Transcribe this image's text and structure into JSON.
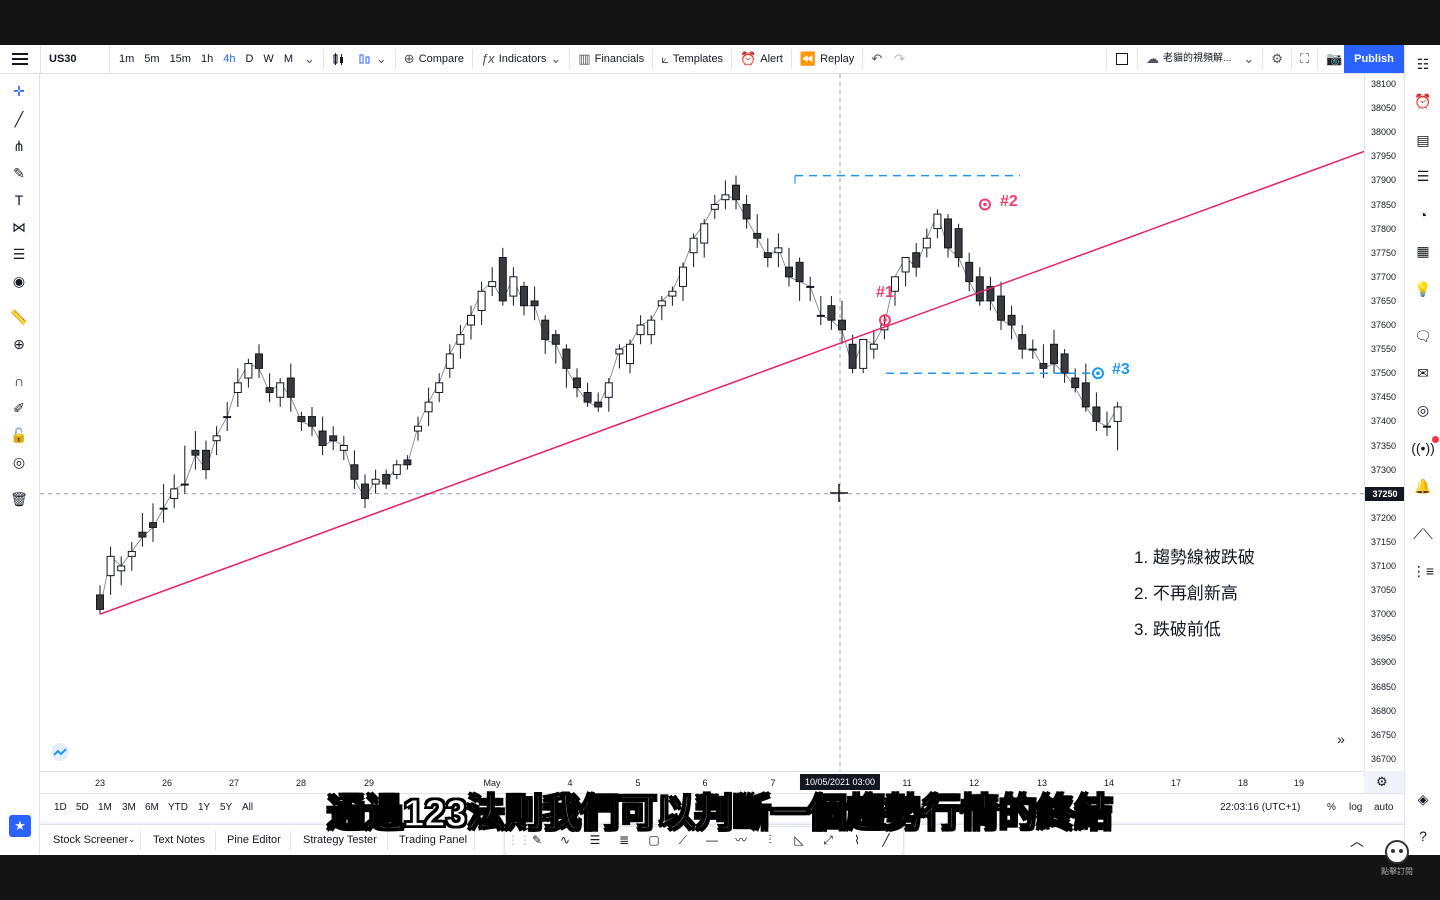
{
  "header": {
    "symbol": "US30",
    "intervals": [
      "1m",
      "5m",
      "15m",
      "1h",
      "4h",
      "D",
      "W",
      "M"
    ],
    "active_interval": "4h",
    "compare": "Compare",
    "indicators": "Indicators",
    "financials": "Financials",
    "templates": "Templates",
    "alert": "Alert",
    "replay": "Replay",
    "layout_name": "老貓的視頻解...",
    "publish": "Publish"
  },
  "price_axis": {
    "labels": [
      "38100",
      "38050",
      "38000",
      "37950",
      "37900",
      "37850",
      "37800",
      "37750",
      "37700",
      "37650",
      "37600",
      "37550",
      "37500",
      "37450",
      "37400",
      "37350",
      "37300",
      "37250",
      "37200",
      "37150",
      "37100",
      "37050",
      "37000",
      "36950",
      "36900",
      "36850",
      "36800",
      "36750",
      "36700"
    ],
    "current": "37250"
  },
  "time_axis": {
    "labels": [
      "23",
      "26",
      "27",
      "28",
      "29",
      "May",
      "4",
      "5",
      "6",
      "7",
      "11",
      "12",
      "13",
      "14",
      "17",
      "18",
      "19"
    ],
    "current": "10/05/2021  03:00"
  },
  "range_bar": {
    "ranges": [
      "1D",
      "5D",
      "1M",
      "3M",
      "6M",
      "YTD",
      "1Y",
      "5Y",
      "All"
    ],
    "clock": "22:03:16 (UTC+1)",
    "percent": "%",
    "log": "log",
    "auto": "auto"
  },
  "bottom_tabs": [
    "Stock Screener",
    "Text Notes",
    "Pine Editor",
    "Strategy Tester",
    "Trading Panel"
  ],
  "annotations": {
    "marker1": "#1",
    "marker2": "#2",
    "marker3": "#3",
    "notes": [
      "1. 趨勢線被跌破",
      "2. 不再創新高",
      "3. 跌破前低"
    ]
  },
  "subtitle": "通過123法則我們可以判斷一個趨勢行情的終結",
  "watermark": "點擊訂閱",
  "colors": {
    "accent": "#2962ff",
    "trendline": "#e91e63",
    "dashed": "#2196f3",
    "marker_red": "#f23c6f",
    "marker_blue": "#2196f3"
  },
  "chart_data": {
    "type": "candlestick",
    "symbol": "US30",
    "interval": "4h",
    "ylim": [
      36700,
      38100
    ],
    "candles": [
      {
        "o": 37040,
        "h": 37060,
        "c": 37010,
        "l": 37000
      },
      {
        "o": 37080,
        "h": 37140,
        "c": 37120,
        "l": 37040
      },
      {
        "o": 37090,
        "h": 37120,
        "c": 37100,
        "l": 37060
      },
      {
        "o": 37120,
        "h": 37150,
        "c": 37130,
        "l": 37090
      },
      {
        "o": 37170,
        "h": 37210,
        "c": 37160,
        "l": 37140
      },
      {
        "o": 37190,
        "h": 37230,
        "c": 37180,
        "l": 37150
      },
      {
        "o": 37220,
        "h": 37270,
        "c": 37220,
        "l": 37190
      },
      {
        "o": 37240,
        "h": 37290,
        "c": 37260,
        "l": 37220
      },
      {
        "o": 37270,
        "h": 37350,
        "c": 37270,
        "l": 37250
      },
      {
        "o": 37340,
        "h": 37380,
        "c": 37330,
        "l": 37300
      },
      {
        "o": 37340,
        "h": 37360,
        "c": 37300,
        "l": 37280
      },
      {
        "o": 37360,
        "h": 37390,
        "c": 37370,
        "l": 37330
      },
      {
        "o": 37410,
        "h": 37440,
        "c": 37410,
        "l": 37380
      },
      {
        "o": 37460,
        "h": 37510,
        "c": 37480,
        "l": 37430
      },
      {
        "o": 37490,
        "h": 37530,
        "c": 37520,
        "l": 37470
      },
      {
        "o": 37540,
        "h": 37560,
        "c": 37510,
        "l": 37490
      },
      {
        "o": 37470,
        "h": 37500,
        "c": 37460,
        "l": 37440
      },
      {
        "o": 37450,
        "h": 37490,
        "c": 37480,
        "l": 37430
      },
      {
        "o": 37490,
        "h": 37520,
        "c": 37450,
        "l": 37420
      },
      {
        "o": 37410,
        "h": 37420,
        "c": 37400,
        "l": 37380
      },
      {
        "o": 37410,
        "h": 37430,
        "c": 37390,
        "l": 37370
      },
      {
        "o": 37380,
        "h": 37410,
        "c": 37350,
        "l": 37330
      },
      {
        "o": 37370,
        "h": 37390,
        "c": 37360,
        "l": 37340
      },
      {
        "o": 37340,
        "h": 37370,
        "c": 37350,
        "l": 37320
      },
      {
        "o": 37310,
        "h": 37340,
        "c": 37280,
        "l": 37260
      },
      {
        "o": 37270,
        "h": 37290,
        "c": 37240,
        "l": 37220
      },
      {
        "o": 37270,
        "h": 37300,
        "c": 37280,
        "l": 37250
      },
      {
        "o": 37290,
        "h": 37300,
        "c": 37270,
        "l": 37260
      },
      {
        "o": 37290,
        "h": 37320,
        "c": 37310,
        "l": 37280
      },
      {
        "o": 37320,
        "h": 37330,
        "c": 37310,
        "l": 37300
      },
      {
        "o": 37380,
        "h": 37410,
        "c": 37390,
        "l": 37360
      },
      {
        "o": 37420,
        "h": 37470,
        "c": 37440,
        "l": 37390
      },
      {
        "o": 37460,
        "h": 37500,
        "c": 37480,
        "l": 37440
      },
      {
        "o": 37510,
        "h": 37560,
        "c": 37540,
        "l": 37490
      },
      {
        "o": 37560,
        "h": 37600,
        "c": 37580,
        "l": 37530
      },
      {
        "o": 37600,
        "h": 37640,
        "c": 37620,
        "l": 37570
      },
      {
        "o": 37630,
        "h": 37690,
        "c": 37670,
        "l": 37600
      },
      {
        "o": 37680,
        "h": 37720,
        "c": 37690,
        "l": 37660
      },
      {
        "o": 37740,
        "h": 37760,
        "c": 37650,
        "l": 37640
      },
      {
        "o": 37660,
        "h": 37720,
        "c": 37700,
        "l": 37640
      },
      {
        "o": 37680,
        "h": 37690,
        "c": 37640,
        "l": 37620
      },
      {
        "o": 37650,
        "h": 37680,
        "c": 37640,
        "l": 37610
      },
      {
        "o": 37610,
        "h": 37620,
        "c": 37570,
        "l": 37540
      },
      {
        "o": 37580,
        "h": 37590,
        "c": 37560,
        "l": 37520
      },
      {
        "o": 37550,
        "h": 37560,
        "c": 37510,
        "l": 37470
      },
      {
        "o": 37490,
        "h": 37510,
        "c": 37470,
        "l": 37450
      },
      {
        "o": 37460,
        "h": 37480,
        "c": 37440,
        "l": 37430
      },
      {
        "o": 37440,
        "h": 37460,
        "c": 37430,
        "l": 37420
      },
      {
        "o": 37450,
        "h": 37490,
        "c": 37480,
        "l": 37420
      },
      {
        "o": 37540,
        "h": 37560,
        "c": 37550,
        "l": 37510
      },
      {
        "o": 37520,
        "h": 37570,
        "c": 37560,
        "l": 37500
      },
      {
        "o": 37580,
        "h": 37620,
        "c": 37600,
        "l": 37560
      },
      {
        "o": 37580,
        "h": 37620,
        "c": 37610,
        "l": 37560
      },
      {
        "o": 37640,
        "h": 37660,
        "c": 37650,
        "l": 37610
      },
      {
        "o": 37660,
        "h": 37680,
        "c": 37670,
        "l": 37640
      },
      {
        "o": 37680,
        "h": 37730,
        "c": 37720,
        "l": 37650
      },
      {
        "o": 37750,
        "h": 37790,
        "c": 37780,
        "l": 37720
      },
      {
        "o": 37770,
        "h": 37820,
        "c": 37810,
        "l": 37740
      },
      {
        "o": 37840,
        "h": 37870,
        "c": 37850,
        "l": 37820
      },
      {
        "o": 37860,
        "h": 37900,
        "c": 37870,
        "l": 37840
      },
      {
        "o": 37890,
        "h": 37910,
        "c": 37860,
        "l": 37840
      },
      {
        "o": 37850,
        "h": 37870,
        "c": 37820,
        "l": 37800
      },
      {
        "o": 37790,
        "h": 37830,
        "c": 37780,
        "l": 37760
      },
      {
        "o": 37750,
        "h": 37780,
        "c": 37740,
        "l": 37720
      },
      {
        "o": 37750,
        "h": 37790,
        "c": 37760,
        "l": 37720
      },
      {
        "o": 37720,
        "h": 37760,
        "c": 37700,
        "l": 37680
      },
      {
        "o": 37730,
        "h": 37740,
        "c": 37690,
        "l": 37650
      },
      {
        "o": 37680,
        "h": 37700,
        "c": 37680,
        "l": 37650
      },
      {
        "o": 37620,
        "h": 37660,
        "c": 37620,
        "l": 37600
      },
      {
        "o": 37640,
        "h": 37660,
        "c": 37610,
        "l": 37590
      },
      {
        "o": 37610,
        "h": 37650,
        "c": 37590,
        "l": 37560
      },
      {
        "o": 37560,
        "h": 37580,
        "c": 37510,
        "l": 37500
      },
      {
        "o": 37510,
        "h": 37570,
        "c": 37570,
        "l": 37500
      },
      {
        "o": 37550,
        "h": 37590,
        "c": 37560,
        "l": 37530
      },
      {
        "o": 37590,
        "h": 37620,
        "c": 37600,
        "l": 37570
      },
      {
        "o": 37670,
        "h": 37700,
        "c": 37700,
        "l": 37640
      },
      {
        "o": 37710,
        "h": 37740,
        "c": 37740,
        "l": 37680
      },
      {
        "o": 37750,
        "h": 37770,
        "c": 37720,
        "l": 37700
      },
      {
        "o": 37760,
        "h": 37800,
        "c": 37780,
        "l": 37740
      },
      {
        "o": 37800,
        "h": 37840,
        "c": 37830,
        "l": 37780
      },
      {
        "o": 37820,
        "h": 37830,
        "c": 37760,
        "l": 37740
      },
      {
        "o": 37800,
        "h": 37810,
        "c": 37740,
        "l": 37720
      },
      {
        "o": 37730,
        "h": 37750,
        "c": 37690,
        "l": 37670
      },
      {
        "o": 37700,
        "h": 37720,
        "c": 37650,
        "l": 37640
      },
      {
        "o": 37680,
        "h": 37700,
        "c": 37650,
        "l": 37630
      },
      {
        "o": 37660,
        "h": 37690,
        "c": 37610,
        "l": 37590
      },
      {
        "o": 37620,
        "h": 37640,
        "c": 37600,
        "l": 37570
      },
      {
        "o": 37580,
        "h": 37600,
        "c": 37550,
        "l": 37530
      },
      {
        "o": 37550,
        "h": 37570,
        "c": 37550,
        "l": 37530
      },
      {
        "o": 37520,
        "h": 37560,
        "c": 37510,
        "l": 37490
      },
      {
        "o": 37560,
        "h": 37590,
        "c": 37520,
        "l": 37500
      },
      {
        "o": 37540,
        "h": 37550,
        "c": 37500,
        "l": 37480
      },
      {
        "o": 37490,
        "h": 37510,
        "c": 37470,
        "l": 37460
      },
      {
        "o": 37480,
        "h": 37520,
        "c": 37430,
        "l": 37420
      },
      {
        "o": 37430,
        "h": 37460,
        "c": 37400,
        "l": 37380
      },
      {
        "o": 37390,
        "h": 37420,
        "c": 37390,
        "l": 37370
      },
      {
        "o": 37400,
        "h": 37440,
        "c": 37430,
        "l": 37340
      }
    ],
    "trendline": {
      "from": 37000,
      "to": 37960
    },
    "support_level": 37500,
    "resistance_level": 37910,
    "crosshair_price": 37250
  }
}
